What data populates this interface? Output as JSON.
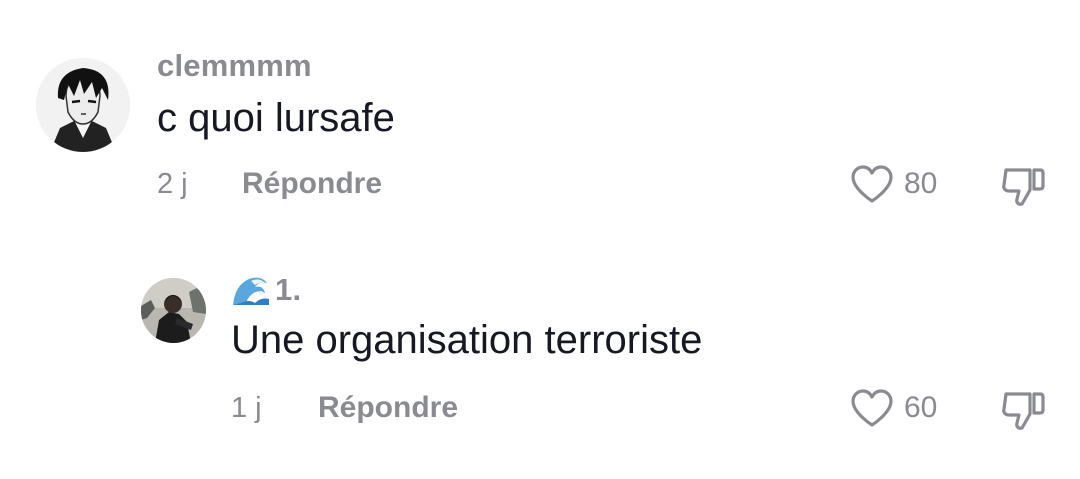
{
  "comments": [
    {
      "username": "clemmmm",
      "text": "c quoi lursafe",
      "time": "2 j",
      "reply_label": "Répondre",
      "likes": "80",
      "avatar_icon": "manga-character-avatar-icon"
    }
  ],
  "replies": [
    {
      "username_emoji": "wave-emoji-icon",
      "username": "1.",
      "text": "Une organisation terroriste",
      "time": "1 j",
      "reply_label": "Répondre",
      "likes": "60",
      "avatar_icon": "person-photo-avatar-icon"
    }
  ],
  "colors": {
    "primary_text": "#161823",
    "secondary_text": "#8a8b91",
    "icon_stroke": "#8a8b91"
  }
}
